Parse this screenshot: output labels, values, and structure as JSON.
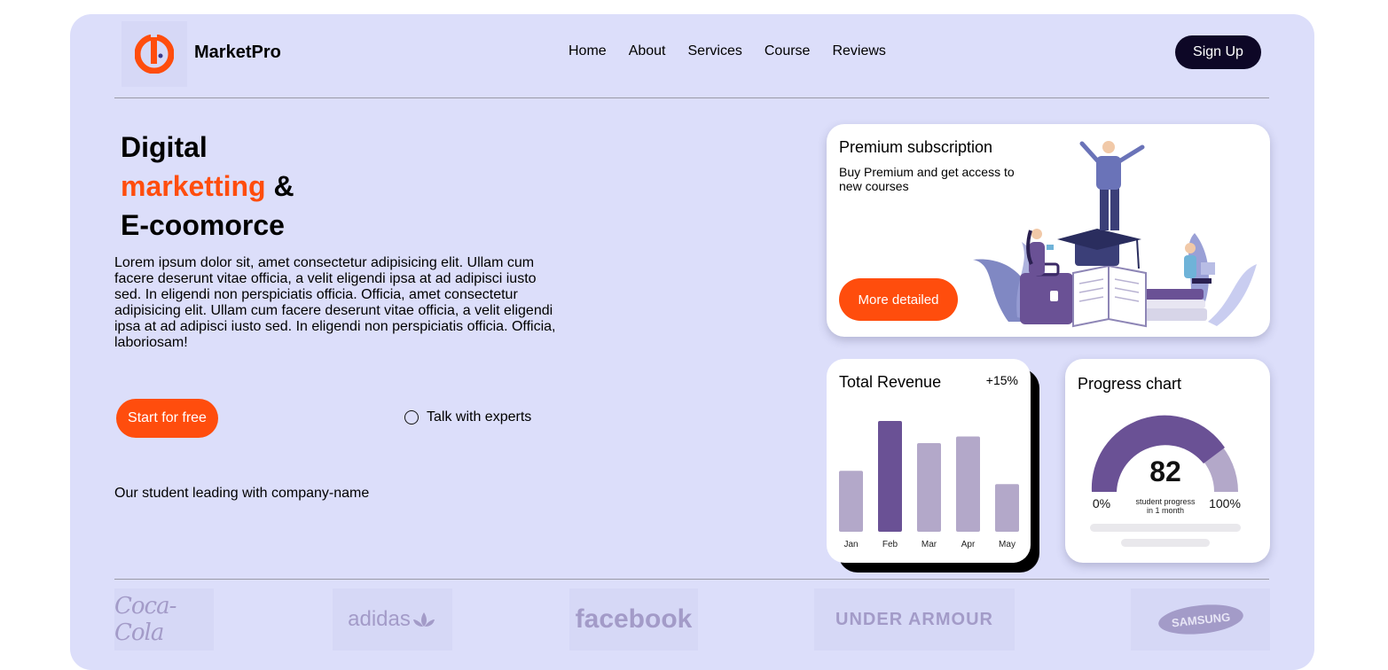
{
  "header": {
    "brand": "MarketPro",
    "nav": [
      "Home",
      "About",
      "Services",
      "Course",
      "Reviews"
    ],
    "signup": "Sign Up"
  },
  "hero": {
    "title_line1": "Digital",
    "title_accent": "marketting",
    "title_amp": "&",
    "title_line3": "E-coomorce",
    "body": "Lorem ipsum dolor sit, amet consectetur adipisicing elit. Ullam cum facere deserunt vitae officia, a velit eligendi ipsa at ad adipisci iusto sed. In eligendi non perspiciatis officia. Officia, amet consectetur adipisicing elit. Ullam cum facere deserunt vitae officia, a velit eligendi ipsa at ad adipisci iusto sed. In eligendi non perspiciatis officia. Officia, laboriosam!",
    "start_button": "Start for free",
    "talk_label": "Talk with experts",
    "student_text": "Our student leading with company-name"
  },
  "premium": {
    "title": "Premium subscription",
    "desc": "Buy Premium and get access to new courses",
    "button": "More detailed"
  },
  "revenue": {
    "title": "Total Revenue",
    "change": "+15%"
  },
  "progress": {
    "title": "Progress chart",
    "value": "82",
    "min_label": "0%",
    "max_label": "100%",
    "caption_line1": "student progress",
    "caption_line2": "in 1 month"
  },
  "chart_data": {
    "type": "bar",
    "title": "Total Revenue",
    "categories": [
      "Jan",
      "Feb",
      "Mar",
      "Apr",
      "May"
    ],
    "values": [
      55,
      100,
      80,
      86,
      43
    ],
    "highlight": "Feb",
    "colors": {
      "bar": "#b3a8c9",
      "highlight": "#6a5195"
    }
  },
  "brands": [
    "Coca-Cola",
    "adidas",
    "facebook",
    "UNDER ARMOUR",
    "SAMSUNG"
  ],
  "colors": {
    "accent": "#ff4d0d",
    "background": "#dcdefa",
    "dark": "#0d0726",
    "purple": "#6a5195",
    "light_purple": "#b3a8c9"
  }
}
